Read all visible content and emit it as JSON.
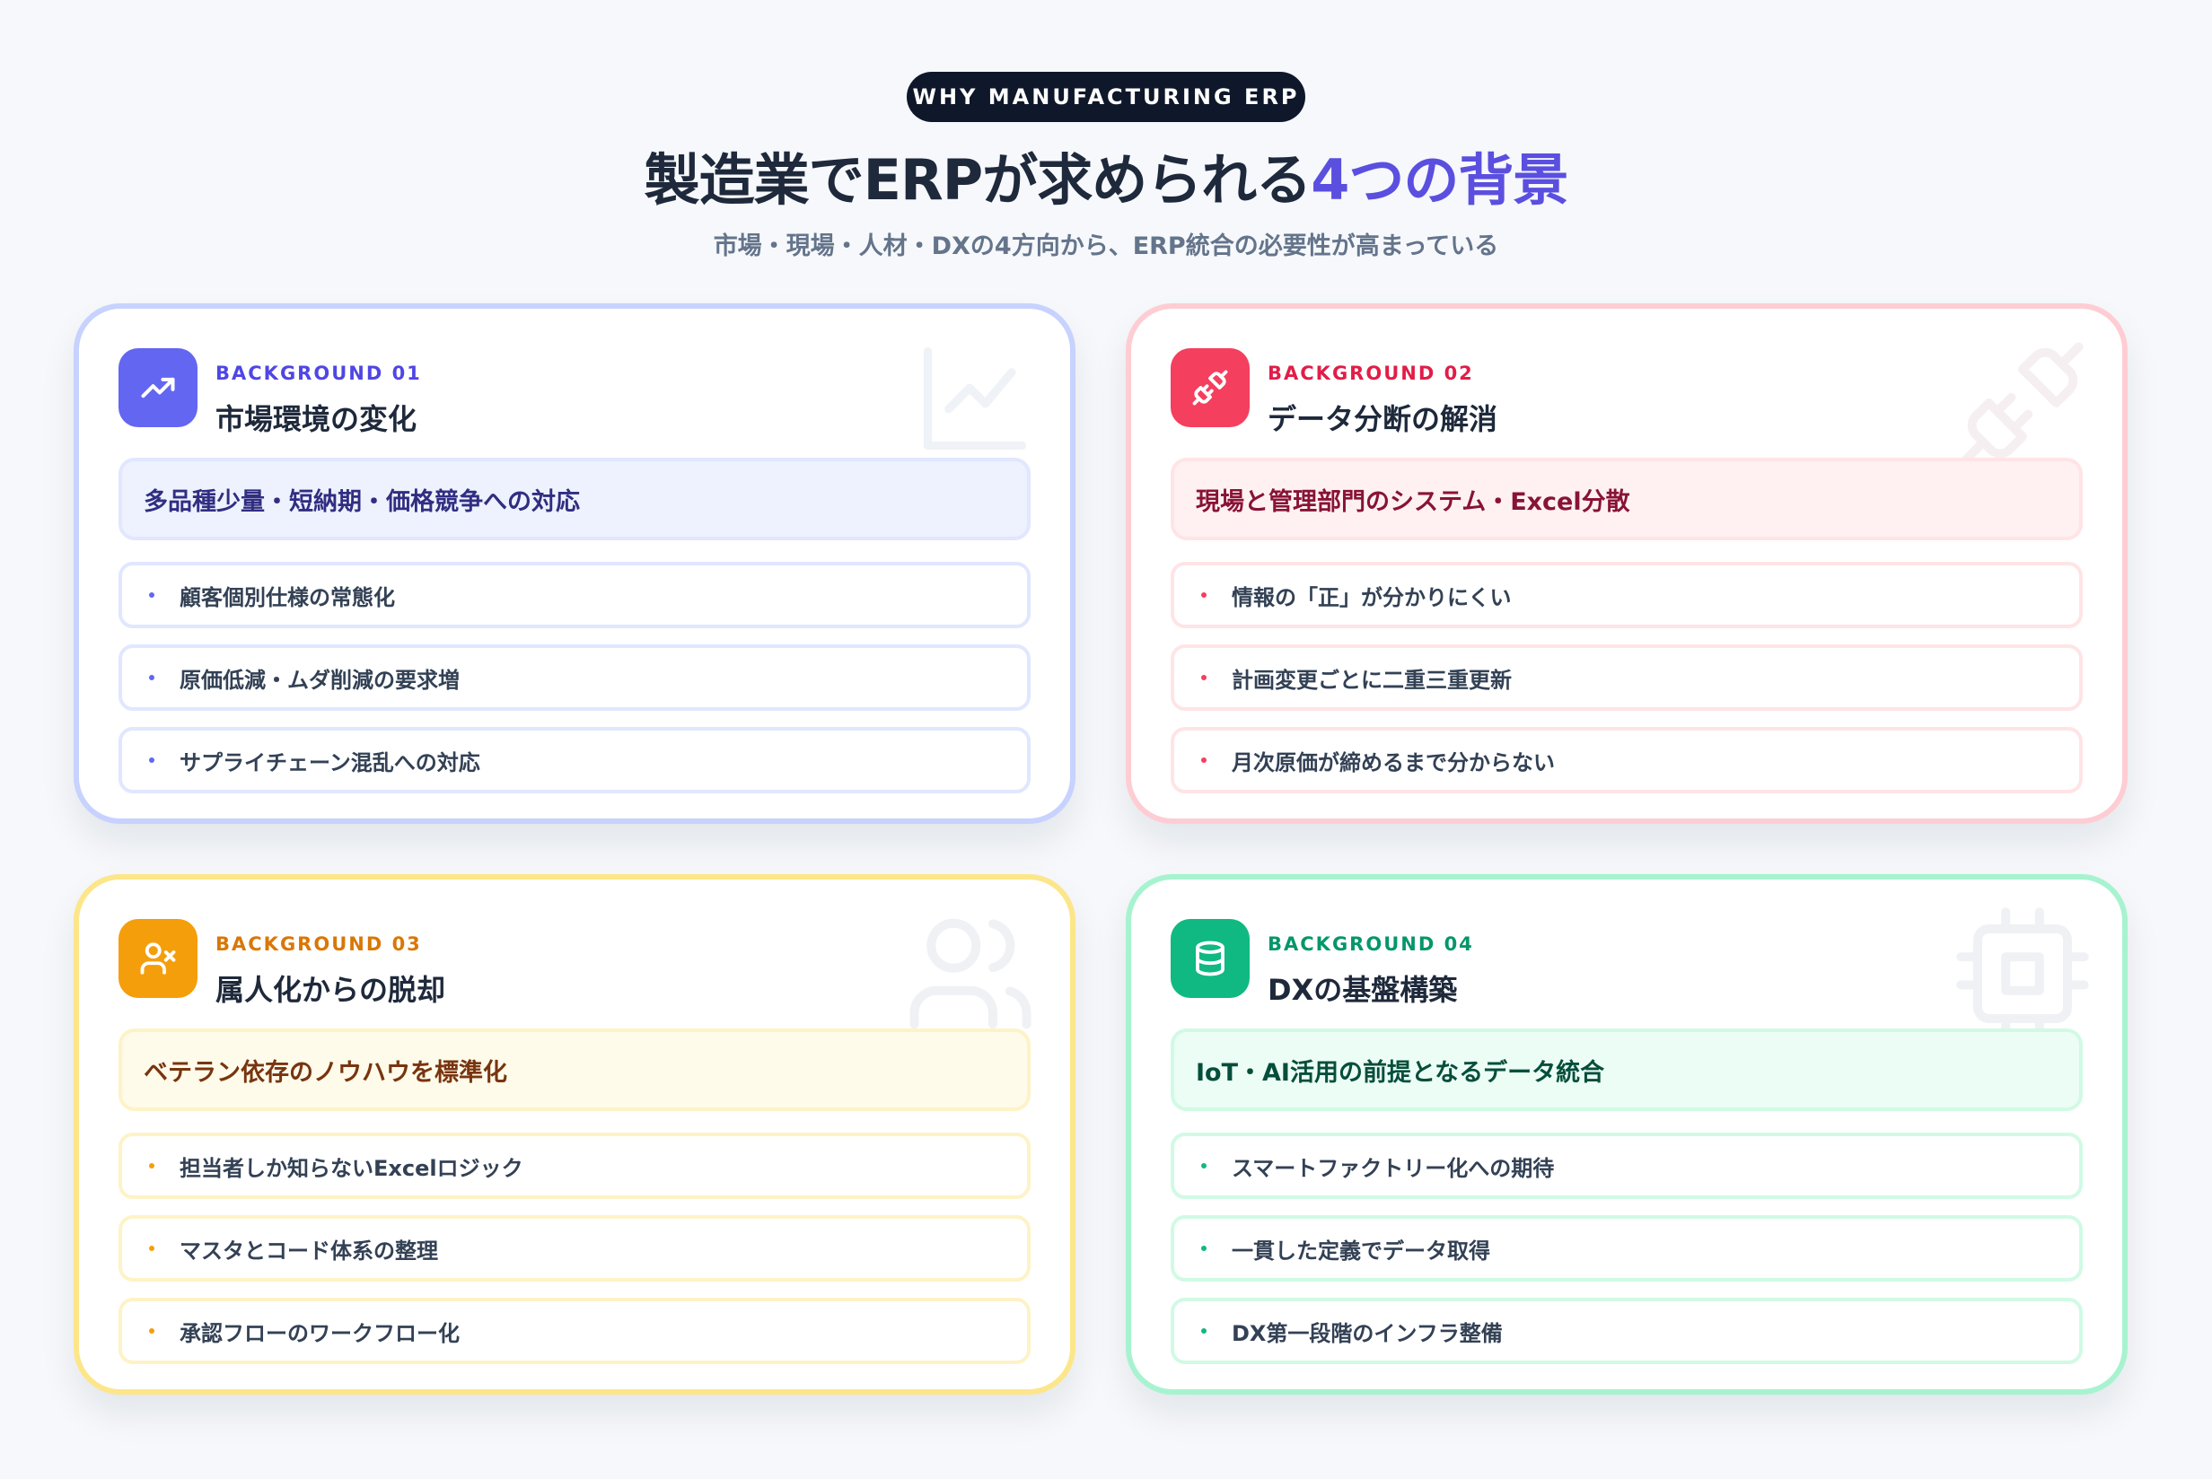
{
  "header": {
    "pill": "WHY MANUFACTURING ERP",
    "title_main": "製造業でERPが求められる",
    "title_accent": "4つの背景",
    "subtitle": "市場・現場・人材・DXの4方向から、ERP統合の必要性が高まっている"
  },
  "colors": {
    "card1": "#6366f1",
    "card2": "#f43f5e",
    "card3": "#f59e0b",
    "card4": "#10b981",
    "accent": "#5b4fe0"
  },
  "cards": [
    {
      "kicker": "BACKGROUND 01",
      "title": "市場環境の変化",
      "icon": "trending-up-icon",
      "banner": "多品種少量・短納期・価格競争への対応",
      "items": [
        "顧客個別仕様の常態化",
        "原価低減・ムダ削減の要求増",
        "サプライチェーン混乱への対応"
      ]
    },
    {
      "kicker": "BACKGROUND 02",
      "title": "データ分断の解消",
      "icon": "unplug-icon",
      "banner": "現場と管理部門のシステム・Excel分散",
      "items": [
        "情報の「正」が分かりにくい",
        "計画変更ごとに二重三重更新",
        "月次原価が締めるまで分からない"
      ]
    },
    {
      "kicker": "BACKGROUND 03",
      "title": "属人化からの脱却",
      "icon": "user-x-icon",
      "banner": "ベテラン依存のノウハウを標準化",
      "items": [
        "担当者しか知らないExcelロジック",
        "マスタとコード体系の整理",
        "承認フローのワークフロー化"
      ]
    },
    {
      "kicker": "BACKGROUND 04",
      "title": "DXの基盤構築",
      "icon": "database-icon",
      "banner": "IoT・AI活用の前提となるデータ統合",
      "items": [
        "スマートファクトリー化への期待",
        "一貫した定義でデータ取得",
        "DX第一段階のインフラ整備"
      ]
    }
  ]
}
